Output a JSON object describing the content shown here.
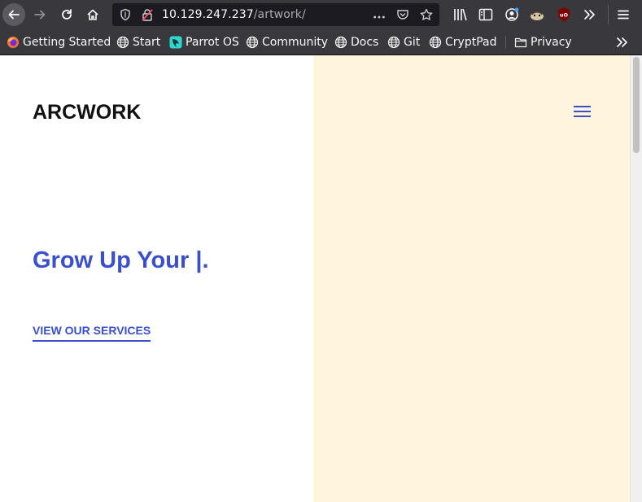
{
  "browser": {
    "url_host": "10.129.247.237",
    "url_path": "/artwork/"
  },
  "bookmarks": [
    {
      "label": "Getting Started",
      "icon": "firefox-icon"
    },
    {
      "label": "Start",
      "icon": "globe-icon"
    },
    {
      "label": "Parrot OS",
      "icon": "parrot-icon"
    },
    {
      "label": "Community",
      "icon": "globe-icon"
    },
    {
      "label": "Docs",
      "icon": "globe-icon"
    },
    {
      "label": "Git",
      "icon": "globe-icon"
    },
    {
      "label": "CryptPad",
      "icon": "globe-icon"
    },
    {
      "label": "Privacy",
      "icon": "folder-icon"
    }
  ],
  "site": {
    "brand": "ARCWORK",
    "hero_title": "Grow Up Your |.",
    "cta_label": "VIEW OUR SERVICES"
  },
  "colors": {
    "accent": "#3b4fcc",
    "right_pane_bg": "#fff5dc",
    "chrome_bg": "#38383d"
  }
}
